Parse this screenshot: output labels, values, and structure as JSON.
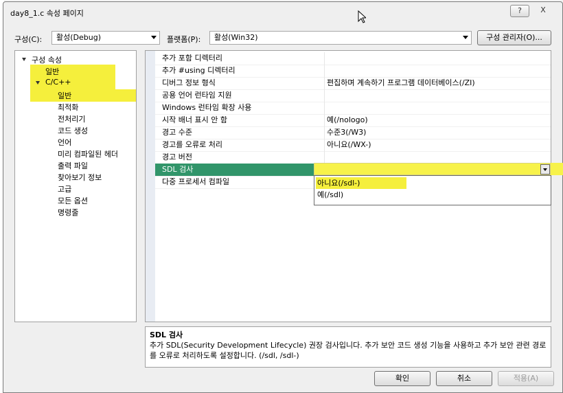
{
  "window": {
    "title": "day8_1.c 속성 페이지",
    "help_label": "?",
    "close_label": "X"
  },
  "toolbar": {
    "config_label": "구성(C):",
    "config_value": "활성(Debug)",
    "platform_label": "플랫폼(P):",
    "platform_value": "활성(Win32)",
    "config_manager_label": "구성 관리자(O)..."
  },
  "tree": {
    "root": "구성 속성",
    "general": "일반",
    "cpp": "C/C++",
    "children": [
      "일반",
      "최적화",
      "전처리기",
      "코드 생성",
      "언어",
      "미리 컴파일된 헤더",
      "출력 파일",
      "찾아보기 정보",
      "고급",
      "모든 옵션",
      "명령줄"
    ]
  },
  "properties": [
    {
      "name": "추가 포함 디렉터리",
      "value": ""
    },
    {
      "name": "추가 #using 디렉터리",
      "value": ""
    },
    {
      "name": "디버그 정보 형식",
      "value": "편집하며 계속하기 프로그램 데이터베이스(/ZI)"
    },
    {
      "name": "공용 언어 런타임 지원",
      "value": ""
    },
    {
      "name": "Windows 런타임 확장 사용",
      "value": ""
    },
    {
      "name": "시작 배너 표시 안 함",
      "value": "예(/nologo)"
    },
    {
      "name": "경고 수준",
      "value": "수준3(/W3)"
    },
    {
      "name": "경고를 오류로 처리",
      "value": "아니요(/WX-)"
    },
    {
      "name": "경고 버전",
      "value": ""
    },
    {
      "name": "SDL 검사",
      "value": ""
    },
    {
      "name": "다중 프로세서 컴파일",
      "value": ""
    }
  ],
  "dropdown": {
    "options": [
      "아니요(/sdl-)",
      "예(/sdl)"
    ]
  },
  "description": {
    "title": "SDL 검사",
    "text": "추가 SDL(Security Development Lifecycle) 권장 검사입니다. 추가 보안 코드 생성 기능을 사용하고 추가 보안 관련 경로를 오류로 처리하도록 설정합니다. (/sdl, /sdl-)"
  },
  "buttons": {
    "ok": "확인",
    "cancel": "취소",
    "apply": "적용(A)"
  },
  "colors": {
    "highlight": "#f5ef3c",
    "selection": "#31956a"
  }
}
